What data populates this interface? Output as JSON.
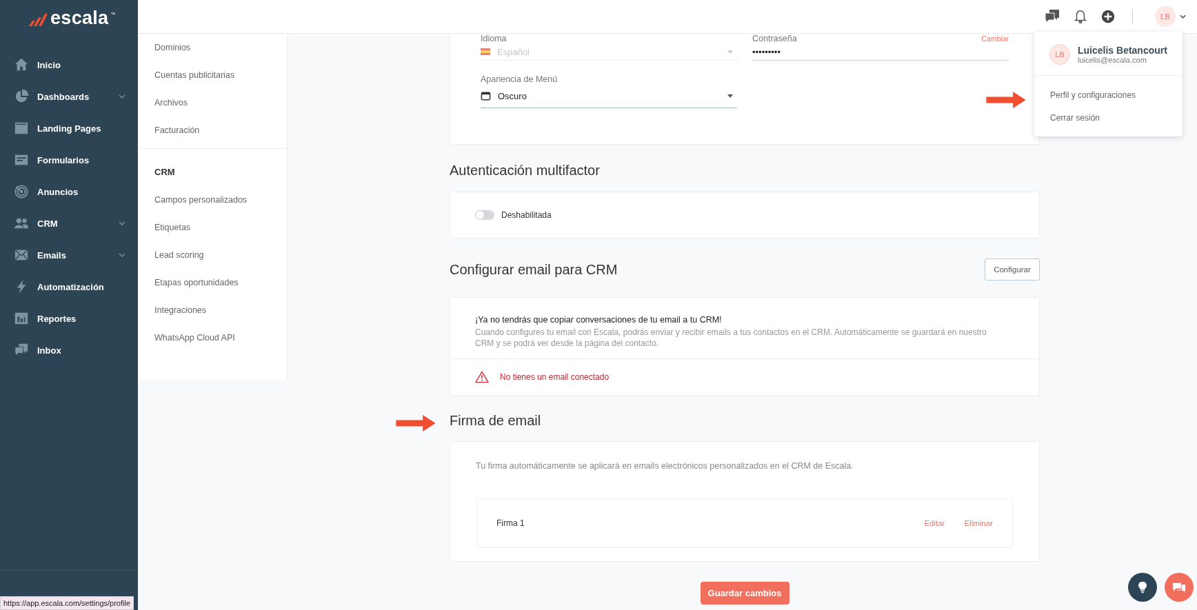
{
  "sidebar": {
    "logo": "escala",
    "trademark": "™",
    "items": [
      {
        "kind": "home",
        "label": "Inicio",
        "expandable": false
      },
      {
        "kind": "pie",
        "label": "Dashboards",
        "expandable": true
      },
      {
        "kind": "page",
        "label": "Landing Pages",
        "expandable": false
      },
      {
        "kind": "form",
        "label": "Formularios",
        "expandable": false
      },
      {
        "kind": "target",
        "label": "Anuncios",
        "expandable": false
      },
      {
        "kind": "people",
        "label": "CRM",
        "expandable": true
      },
      {
        "kind": "mail",
        "label": "Emails",
        "expandable": true
      },
      {
        "kind": "bolt",
        "label": "Automatización",
        "expandable": false
      },
      {
        "kind": "report",
        "label": "Reportes",
        "expandable": false
      },
      {
        "kind": "chat",
        "label": "Inbox",
        "expandable": false
      }
    ]
  },
  "settings_nav": {
    "groups": [
      {
        "items": [
          "Dominios",
          "Cuentas publicitarias",
          "Archivos",
          "Facturación"
        ]
      },
      {
        "title": "CRM",
        "items": [
          "Campos personalizados",
          "Etiquetas",
          "Lead scoring",
          "Etapas oportunidades",
          "Integraciones",
          "WhatsApp Cloud API"
        ]
      }
    ]
  },
  "topbar": {
    "avatar": "LB"
  },
  "user_menu": {
    "avatar": "LB",
    "name": "Luicelis Betancourt",
    "email": "luicelis@escala.com",
    "items": [
      "Perfil y configuraciones",
      "Cerrar sesión"
    ]
  },
  "profile_fields": [
    {
      "kind": "language",
      "label": "Idioma",
      "value": "Español",
      "disabled": true
    },
    {
      "kind": "password",
      "label": "Contraseña",
      "value": "•••••••••",
      "action": "Cambiar",
      "disabled": false
    },
    {
      "kind": "theme",
      "label": "Apariencia de Menú",
      "value": "Oscuro",
      "disabled": false
    }
  ],
  "mfa": {
    "title": "Autenticación multifactor",
    "enabled": false,
    "status": "Deshabilitada"
  },
  "crm_email": {
    "title": "Configurar email para CRM",
    "button": "Configurar",
    "headline": "¡Ya no tendrás que copiar conversaciones de tu email a tu CRM!",
    "description": "Cuando configures tu email con Escala, podrás enviar y recibir emails a tus contactos en el CRM. Automáticamente se guardará en nuestro CRM y se podrá ver desde la página del contacto.",
    "warning": "No tienes un email conectado"
  },
  "signature": {
    "title": "Firma de email",
    "description": "Tu firma automáticamente se aplicará en emails electrónicos personalizados en el CRM de Escala.",
    "signatures": [
      {
        "name": "Firma 1",
        "actions": [
          "Editar",
          "Eliminar"
        ]
      }
    ]
  },
  "save_button": "Guardar cambios",
  "status_url": "https://app.escala.com/settings/profile"
}
